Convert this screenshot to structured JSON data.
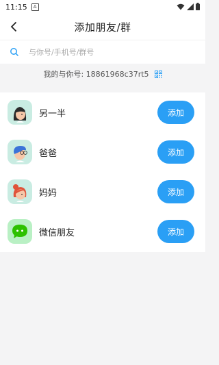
{
  "status_bar": {
    "time": "11:15",
    "badge": "A"
  },
  "header": {
    "title": "添加朋友/群"
  },
  "search": {
    "placeholder": "与你号/手机号/群号"
  },
  "my_id": {
    "label": "我的与你号: 18861968c37rt5"
  },
  "contacts": [
    {
      "name": "另一半",
      "action": "添加",
      "icon": "avatar-woman-icon"
    },
    {
      "name": "爸爸",
      "action": "添加",
      "icon": "avatar-dad-icon"
    },
    {
      "name": "妈妈",
      "action": "添加",
      "icon": "avatar-mom-icon"
    },
    {
      "name": "微信朋友",
      "action": "添加",
      "icon": "wechat-icon"
    }
  ],
  "colors": {
    "accent": "#2a9ff5",
    "wechat": "#2dc100",
    "background": "#f4f4f5"
  }
}
